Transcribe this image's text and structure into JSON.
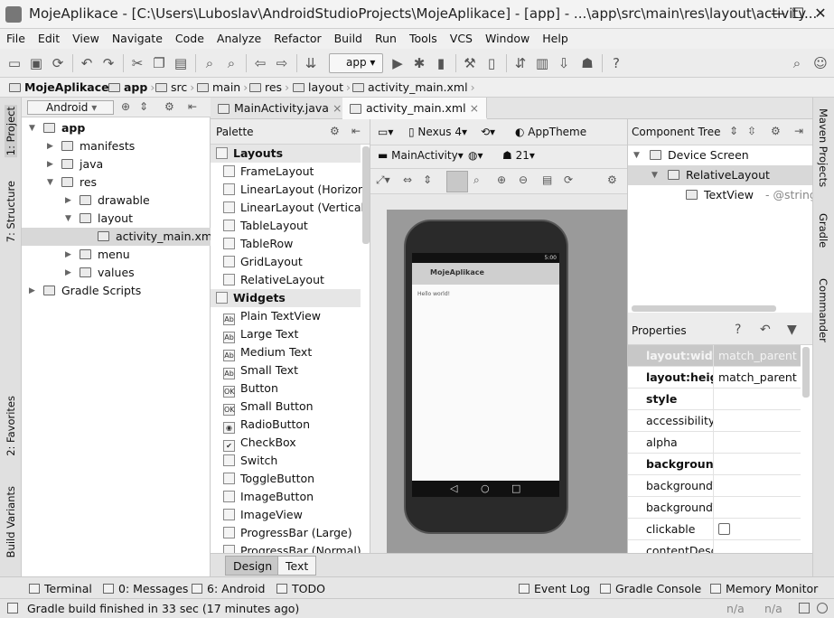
{
  "window": {
    "title": "MojeAplikace - [C:\\Users\\Luboslav\\AndroidStudioProjects\\MojeAplikace] - [app] - ...\\app\\src\\main\\res\\layout\\activity...",
    "minimize": "—",
    "maximize": "☐",
    "close": "✕"
  },
  "menu": [
    "File",
    "Edit",
    "View",
    "Navigate",
    "Code",
    "Analyze",
    "Refactor",
    "Build",
    "Run",
    "Tools",
    "VCS",
    "Window",
    "Help"
  ],
  "toolbar": {
    "run_config": "app"
  },
  "breadcrumb": [
    "MojeAplikace",
    "app",
    "src",
    "main",
    "res",
    "layout",
    "activity_main.xml"
  ],
  "left_strip": [
    "1: Project",
    "7: Structure",
    "2: Favorites",
    "Build Variants"
  ],
  "right_strip": [
    "Maven Projects",
    "Gradle",
    "Commander"
  ],
  "project": {
    "view_mode": "Android",
    "tree": [
      {
        "label": "app",
        "level": 0,
        "expanded": true,
        "bold": true
      },
      {
        "label": "manifests",
        "level": 1,
        "expanded": false
      },
      {
        "label": "java",
        "level": 1,
        "expanded": false
      },
      {
        "label": "res",
        "level": 1,
        "expanded": true
      },
      {
        "label": "drawable",
        "level": 2,
        "expanded": false
      },
      {
        "label": "layout",
        "level": 2,
        "expanded": true
      },
      {
        "label": "activity_main.xml",
        "level": 3,
        "selected": true
      },
      {
        "label": "menu",
        "level": 2,
        "expanded": false
      },
      {
        "label": "values",
        "level": 2,
        "expanded": false
      },
      {
        "label": "Gradle Scripts",
        "level": 0,
        "expanded": false
      }
    ]
  },
  "tabs": [
    {
      "label": "MainActivity.java",
      "close": "×",
      "active": false
    },
    {
      "label": "activity_main.xml",
      "close": "×",
      "active": true
    }
  ],
  "palette": {
    "title": "Palette",
    "items": [
      {
        "label": "Layouts",
        "group": true
      },
      {
        "label": "FrameLayout",
        "icon": ""
      },
      {
        "label": "LinearLayout (Horizontal)",
        "icon": ""
      },
      {
        "label": "LinearLayout (Vertical)",
        "icon": ""
      },
      {
        "label": "TableLayout",
        "icon": ""
      },
      {
        "label": "TableRow",
        "icon": ""
      },
      {
        "label": "GridLayout",
        "icon": ""
      },
      {
        "label": "RelativeLayout",
        "icon": ""
      },
      {
        "label": "Widgets",
        "group": true
      },
      {
        "label": "Plain TextView",
        "icon": "Ab"
      },
      {
        "label": "Large Text",
        "icon": "Ab"
      },
      {
        "label": "Medium Text",
        "icon": "Ab"
      },
      {
        "label": "Small Text",
        "icon": "Ab"
      },
      {
        "label": "Button",
        "icon": "OK"
      },
      {
        "label": "Small Button",
        "icon": "OK"
      },
      {
        "label": "RadioButton",
        "icon": "◉"
      },
      {
        "label": "CheckBox",
        "icon": "✔"
      },
      {
        "label": "Switch",
        "icon": ""
      },
      {
        "label": "ToggleButton",
        "icon": ""
      },
      {
        "label": "ImageButton",
        "icon": ""
      },
      {
        "label": "ImageView",
        "icon": ""
      },
      {
        "label": "ProgressBar (Large)",
        "icon": ""
      },
      {
        "label": "ProgressBar (Normal)",
        "icon": ""
      }
    ]
  },
  "design_toolbar": {
    "device": "Nexus 4",
    "theme": "AppTheme",
    "activity": "MainActivity",
    "api": "21"
  },
  "device_preview": {
    "status_time": "5:00",
    "app_title": "MojeAplikace",
    "content_text": "Hello world!",
    "nav": [
      "◁",
      "○",
      "□"
    ]
  },
  "editor_mode_tabs": [
    {
      "label": "Design",
      "active": true
    },
    {
      "label": "Text",
      "active": false
    }
  ],
  "component_tree": {
    "title": "Component Tree",
    "items": [
      {
        "label": "Device Screen",
        "level": 0
      },
      {
        "label": "RelativeLayout",
        "level": 1,
        "selected": true
      },
      {
        "label": "TextView",
        "level": 2,
        "suffix": " - @string/hell"
      }
    ]
  },
  "properties": {
    "title": "Properties",
    "rows": [
      {
        "name": "layout:width",
        "value": "match_parent",
        "bold": true,
        "selected": true
      },
      {
        "name": "layout:height",
        "value": "match_parent",
        "bold": true
      },
      {
        "name": "style",
        "value": "",
        "bold": true
      },
      {
        "name": "accessibilityLiv",
        "value": ""
      },
      {
        "name": "alpha",
        "value": ""
      },
      {
        "name": "background",
        "value": "",
        "bold": true
      },
      {
        "name": "backgroundTi",
        "value": ""
      },
      {
        "name": "backgroundTi",
        "value": ""
      },
      {
        "name": "clickable",
        "value": "",
        "checkbox": true
      },
      {
        "name": "contentDescri",
        "value": ""
      }
    ]
  },
  "tool_windows": [
    {
      "label": "Terminal"
    },
    {
      "label": "0: Messages"
    },
    {
      "label": "6: Android"
    },
    {
      "label": "TODO"
    },
    {
      "label": "Event Log"
    },
    {
      "label": "Gradle Console"
    },
    {
      "label": "Memory Monitor"
    }
  ],
  "status": {
    "message": "Gradle build finished in 33 sec (17 minutes ago)",
    "pos1": "n/a",
    "pos2": "n/a"
  }
}
